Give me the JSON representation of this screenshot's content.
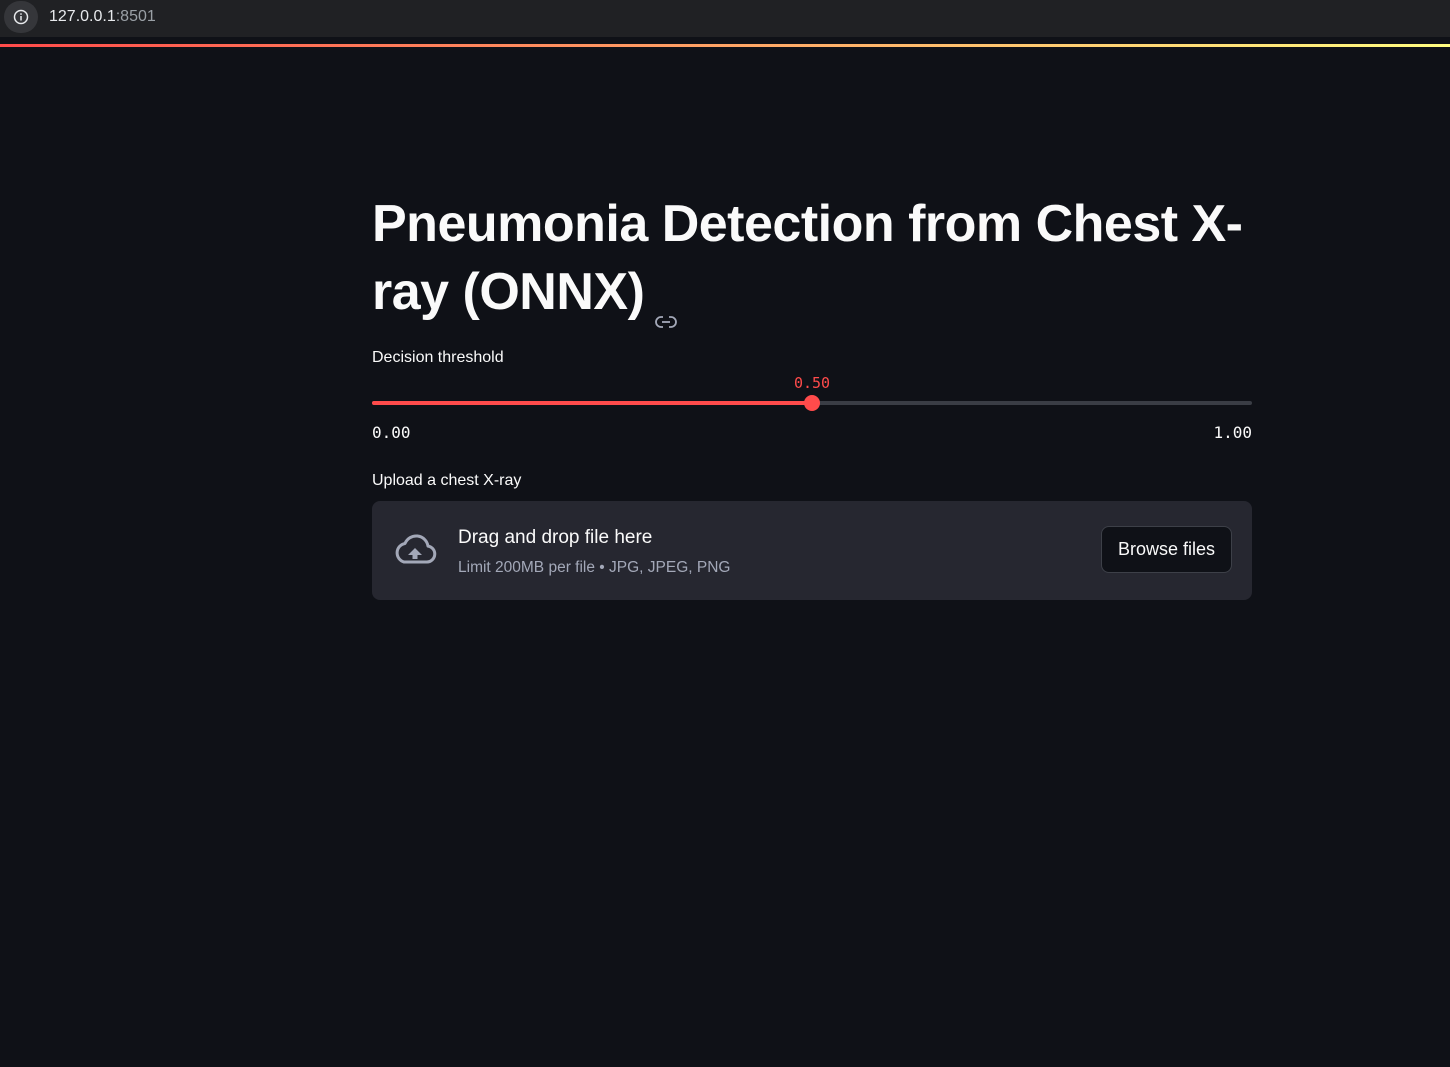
{
  "browser": {
    "url_host": "127.0.0.1",
    "url_port": ":8501",
    "info_icon": "info-icon"
  },
  "page": {
    "title": "Pneumonia Detection from Chest X-ray (ONNX)",
    "anchor_icon": "link-icon"
  },
  "slider": {
    "label": "Decision threshold",
    "value": 0.5,
    "value_text": "0.50",
    "min": 0,
    "max": 1,
    "min_text": "0.00",
    "max_text": "1.00"
  },
  "uploader": {
    "label": "Upload a chest X-ray",
    "icon": "cloud-upload-icon",
    "title": "Drag and drop file here",
    "hint": "Limit 200MB per file • JPG, JPEG, PNG",
    "button_label": "Browse files"
  },
  "colors": {
    "background": "#0f1117",
    "accent": "#ff4b4b",
    "dropzone_bg": "#262730",
    "decoration_gradient_end": "#fffd80"
  }
}
